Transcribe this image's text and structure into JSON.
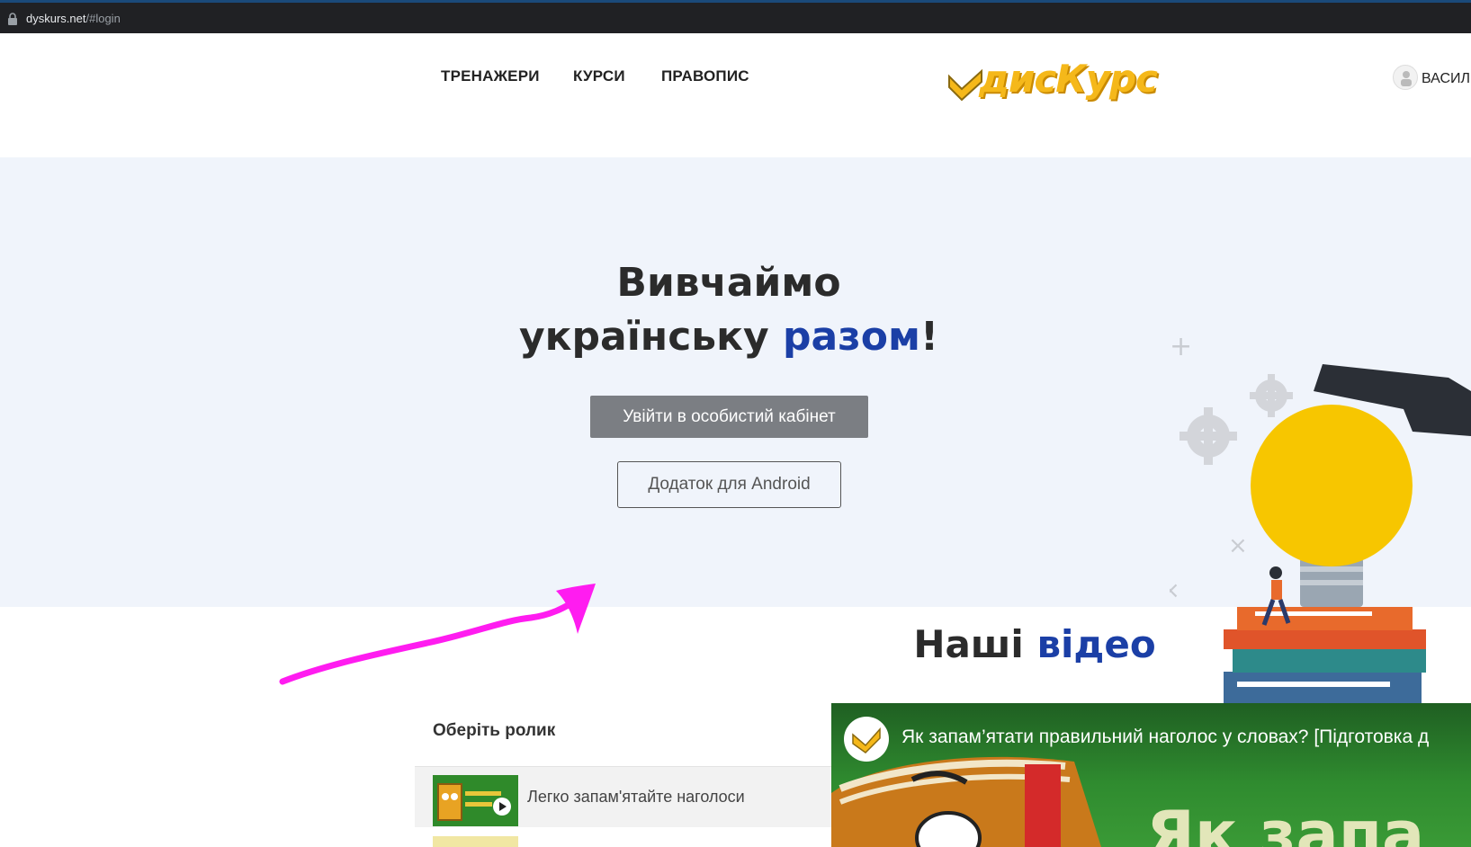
{
  "browser": {
    "url_domain": "dyskurs.net",
    "url_path": "/#login"
  },
  "header": {
    "nav": [
      "ТРЕНАЖЕРИ",
      "КУРСИ",
      "ПРАВОПИС"
    ],
    "logo_text": "дисКурс",
    "user_name": "ВАСИЛ"
  },
  "hero": {
    "title_line1": "Вивчаймо",
    "title_line2_a": "українську",
    "title_line2_accent": "разом",
    "title_line2_end": "!",
    "login_button": "Увійти в особистий кабінет",
    "android_button": "Додаток для Android"
  },
  "videos": {
    "title_a": "Наші",
    "title_accent": "відео",
    "list_title": "Оберіть ролик",
    "items": [
      {
        "label": "Легко запам'ятайте наголоси",
        "thumb_text": "Як запам'ятати наголоси"
      }
    ],
    "player_title": "Як запам’ятати правильний наголос у словах? [Підготовка д"
  },
  "colors": {
    "accent_blue": "#1b3fa6",
    "logo_yellow": "#f5b81a",
    "hero_bg": "#f0f4fb",
    "login_button_bg": "#7b7e83",
    "annotation_magenta": "#ff00ff",
    "player_green": "#2c7a2c"
  },
  "icons": [
    "lock-icon",
    "logo-check-icon",
    "user-avatar-icon",
    "play-icon",
    "channel-logo-icon"
  ]
}
